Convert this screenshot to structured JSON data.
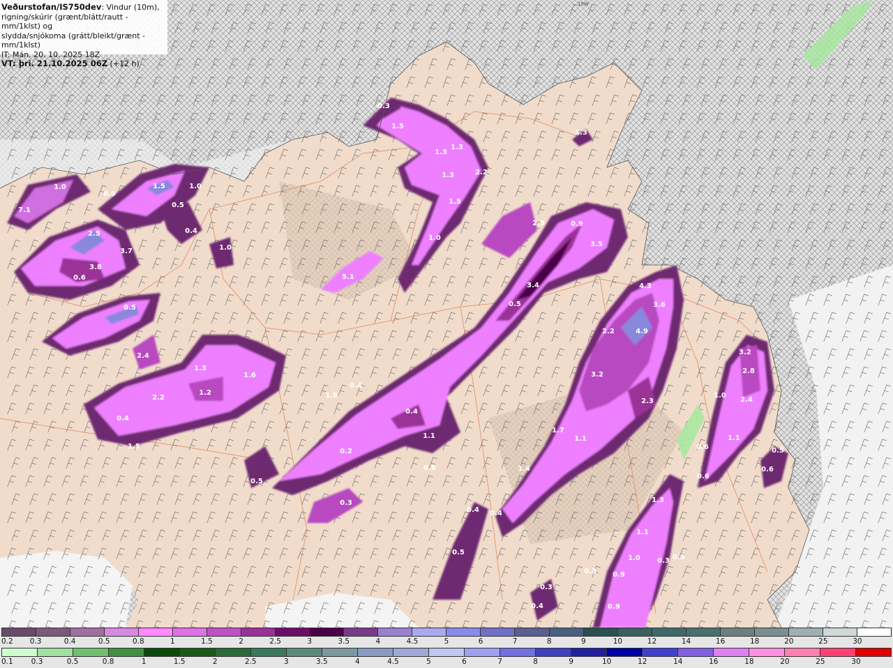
{
  "header": {
    "source": "Veðurstofan/IS750dev",
    "description_line1": ": Vindur (10m),",
    "description_line2": "rigning/skúrir (grænt/blátt/rautt - mm/1klst) og",
    "description_line3": "slydda/snjókoma (grátt/bleikt/grænt - mm/1klst)",
    "issue_time": "IT: Mán. 20. 10. 2025 18Z",
    "valid_time_label": "VT: þri. 21.10.2025 06Z",
    "forecast_offset": "(+12 h)"
  },
  "map_direction_label": "15W",
  "precip_values": [
    "0.3",
    "1.5",
    "1.3",
    "1.3",
    "1.3",
    "2.2",
    "1.5",
    "1.0",
    "1.0",
    "6.9",
    "1.5",
    "1.0",
    "0.5",
    "7.1",
    "2.5",
    "3.7",
    "3.8",
    "0.6",
    "0.4",
    "1.0",
    "5.1",
    "0.5",
    "2.4",
    "1.3",
    "1.6",
    "2.2",
    "1.2",
    "0.4",
    "1.5",
    "2.9",
    "0.9",
    "3.5",
    "3.4",
    "0.5",
    "0.4",
    "1.8",
    "0.4",
    "1.1",
    "0.2",
    "0.5",
    "4.3",
    "3.6",
    "2.2",
    "4.9",
    "3.2",
    "2.3",
    "1.7",
    "1.1",
    "1.4",
    "3.2",
    "2.8",
    "1.0",
    "2.4",
    "1.1",
    "0.6",
    "0.5",
    "0.6",
    "0.6",
    "1.3",
    "1.1",
    "1.0",
    "0.3",
    "0.9",
    "0.9",
    "0.3",
    "0.3",
    "0.4",
    "0.5",
    "0.4",
    "0.4",
    "0.3",
    "0.8",
    "1.3",
    "0.3"
  ],
  "legend_rain": {
    "ticks": [
      "0.2",
      "0.3",
      "0.4",
      "0.5",
      "0.8",
      "1",
      "1.5",
      "2",
      "2.5",
      "3",
      "3.5",
      "4",
      "4.5",
      "5",
      "6",
      "7",
      "8",
      "9",
      "10",
      "12",
      "14",
      "16",
      "18",
      "20",
      "25",
      "30"
    ],
    "colors": [
      "#6a4a6a",
      "#7d5a7d",
      "#a070a0",
      "#d889e0",
      "#ff88ff",
      "#e070e8",
      "#c050c8",
      "#9a3098",
      "#6a1068",
      "#4a0048",
      "#7a3a8a",
      "#9a80d0",
      "#a9a9f2",
      "#8a8ae8",
      "#7070c8",
      "#5a6090",
      "#4a6080",
      "#2a5050",
      "#3a6060",
      "#406a6a",
      "#4a7070",
      "#6a8080",
      "#7a9090",
      "#a0b0b0",
      "#d0d8d8",
      "#ffffff"
    ]
  },
  "legend_snow": {
    "ticks": [
      "0.1",
      "0.3",
      "0.5",
      "0.8",
      "1",
      "1.5",
      "2",
      "2.5",
      "3",
      "3.5",
      "4",
      "4.5",
      "5",
      "6",
      "7",
      "8",
      "9",
      "10",
      "12",
      "14",
      "16",
      "18",
      "20",
      "25",
      "30"
    ],
    "colors": [
      "#d0ffd0",
      "#a0e0a0",
      "#70c070",
      "#409040",
      "#0a4a0a",
      "#1a5a1a",
      "#2a6a3a",
      "#3a7a5a",
      "#5a8a7a",
      "#7a9aa0",
      "#8a9ac0",
      "#a0a8d8",
      "#c0c8f0",
      "#a0a0f0",
      "#7070e0",
      "#4040c0",
      "#2020a0",
      "#0000a0",
      "#4040d0",
      "#8060e0",
      "#e080f0",
      "#ff90e0",
      "#ff80b0",
      "#ff4070",
      "#e00000"
    ]
  },
  "colors": {
    "land": "#f1dccb",
    "sea": "#dcdcdc",
    "precip_light": "#ee80ff",
    "precip_mid": "#b84ac0",
    "precip_dark": "#6e2a70",
    "precip_core": "#8888dd",
    "road": "#e08860"
  }
}
